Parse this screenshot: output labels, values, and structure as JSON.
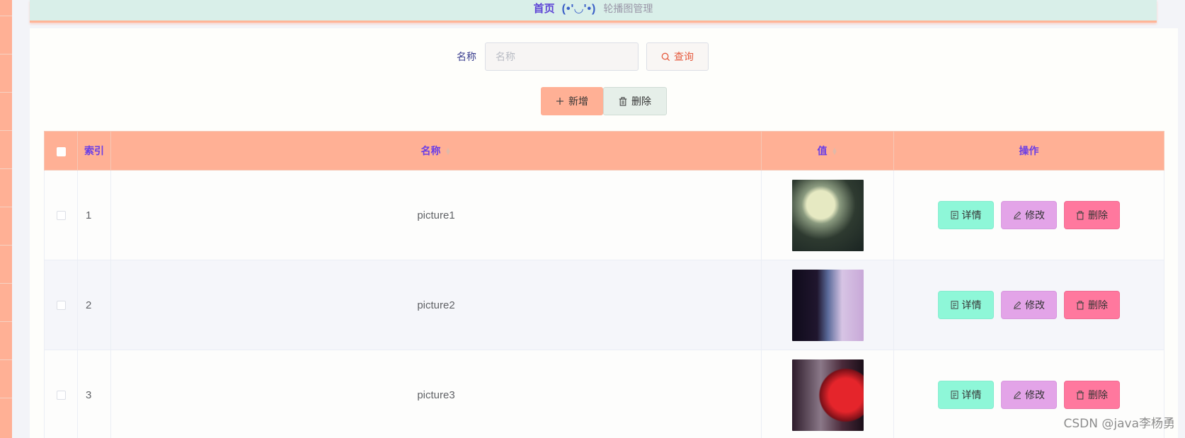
{
  "breadcrumb": {
    "home": "首页",
    "face": "(•'◡'•)",
    "current": "轮播图管理"
  },
  "search": {
    "label": "名称",
    "placeholder": "名称",
    "value": "",
    "button_label": "查询"
  },
  "actions": {
    "add_label": "新增",
    "delete_label": "删除"
  },
  "table": {
    "columns": {
      "index": "索引",
      "name": "名称",
      "value": "值",
      "ops": "操作"
    },
    "rows": [
      {
        "index": "1",
        "name": "picture1"
      },
      {
        "index": "2",
        "name": "picture2"
      },
      {
        "index": "3",
        "name": "picture3"
      }
    ],
    "row_actions": {
      "detail": "详情",
      "edit": "修改",
      "remove": "删除"
    }
  },
  "watermark": "CSDN @java李杨勇",
  "colors": {
    "header": "#ffb095",
    "detail": "#8ef7d8",
    "edit": "#e3a4e8",
    "remove": "#ff789e"
  }
}
